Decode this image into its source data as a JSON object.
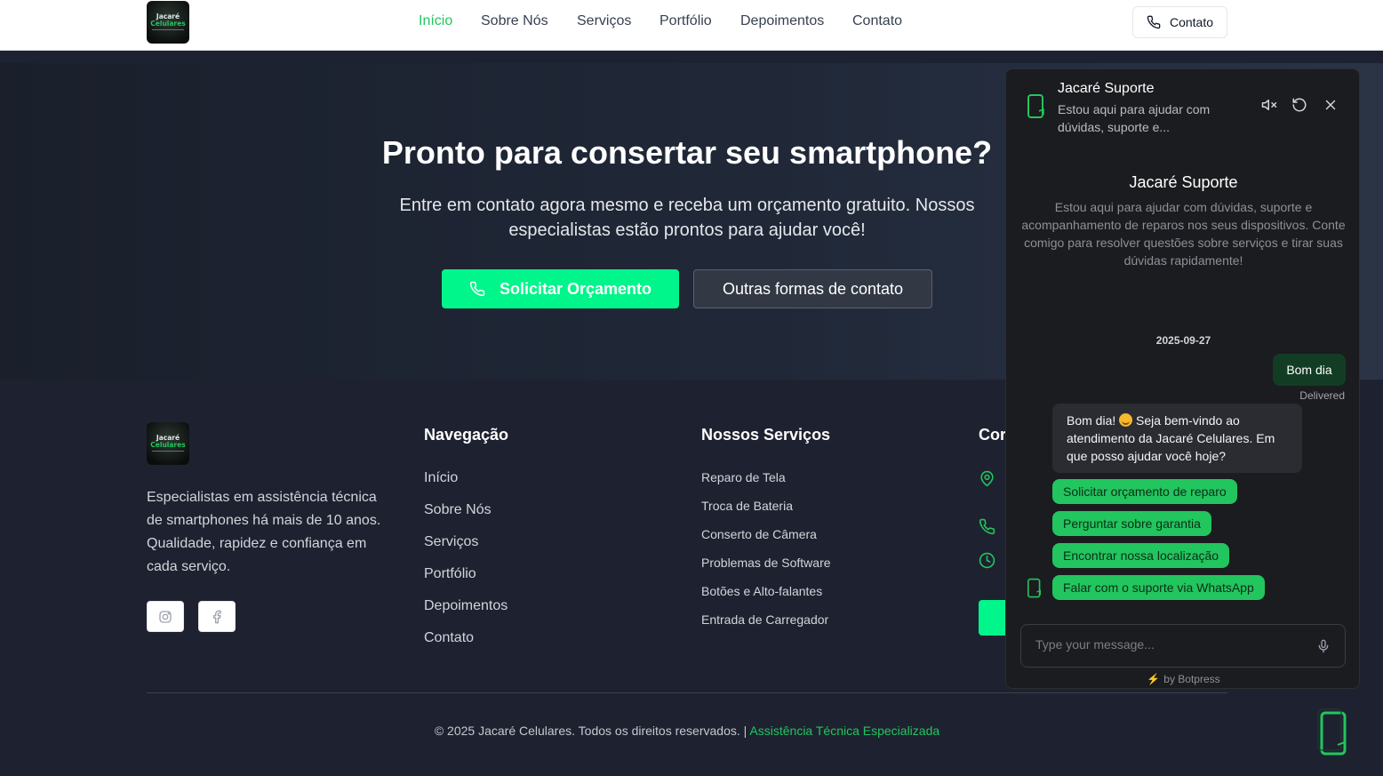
{
  "header": {
    "logo": {
      "line1": "Jacaré",
      "line2": "Celulares"
    },
    "nav": [
      {
        "label": "Início",
        "active": true
      },
      {
        "label": "Sobre Nós",
        "active": false
      },
      {
        "label": "Serviços",
        "active": false
      },
      {
        "label": "Portfólio",
        "active": false
      },
      {
        "label": "Depoimentos",
        "active": false
      },
      {
        "label": "Contato",
        "active": false
      }
    ],
    "contact_button": "Contato"
  },
  "hero": {
    "title": "Pronto para consertar seu smartphone?",
    "subtitle": "Entre em contato agora mesmo e receba um orçamento gratuito. Nossos especialistas estão prontos para ajudar você!",
    "primary_button": "Solicitar Orçamento",
    "secondary_button": "Outras formas de contato"
  },
  "footer": {
    "description": "Especialistas em assistência técnica de smartphones há mais de 10 anos. Qualidade, rapidez e confiança em cada serviço.",
    "nav_title": "Navegação",
    "nav_items": [
      "Início",
      "Sobre Nós",
      "Serviços",
      "Portfólio",
      "Depoimentos",
      "Contato"
    ],
    "services_title": "Nossos Serviços",
    "services": [
      "Reparo de Tela",
      "Troca de Bateria",
      "Conserto de Câmera",
      "Problemas de Software",
      "Botões e Alto-falantes",
      "Entrada de Carregador"
    ],
    "contact_title_partial": "Cor",
    "copyright": "© 2025 Jacaré Celulares. Todos os direitos reservados. |",
    "copyright_highlight": "Assistência Técnica Especializada"
  },
  "chat": {
    "title": "Jacaré Suporte",
    "subtitle": "Estou aqui para ajudar com dúvidas, suporte e...",
    "intro_name": "Jacaré Suporte",
    "intro_description": "Estou aqui para ajudar com dúvidas, suporte e acompanhamento de reparos nos seus dispositivos. Conte comigo para resolver questões sobre serviços e tirar suas dúvidas rapidamente!",
    "date": "2025-09-27",
    "user_message": "Bom dia",
    "delivered": "Delivered",
    "bot_message_before_emoji": "Bom dia!",
    "bot_message_after_emoji": "Seja bem-vindo ao atendimento da Jacaré Celulares. Em que posso ajudar você hoje?",
    "quick_replies": [
      "Solicitar orçamento de reparo",
      "Perguntar sobre garantia",
      "Encontrar nossa localização",
      "Falar com o suporte via WhatsApp"
    ],
    "input_placeholder": "Type your message...",
    "powered_by": "by Botpress"
  }
}
